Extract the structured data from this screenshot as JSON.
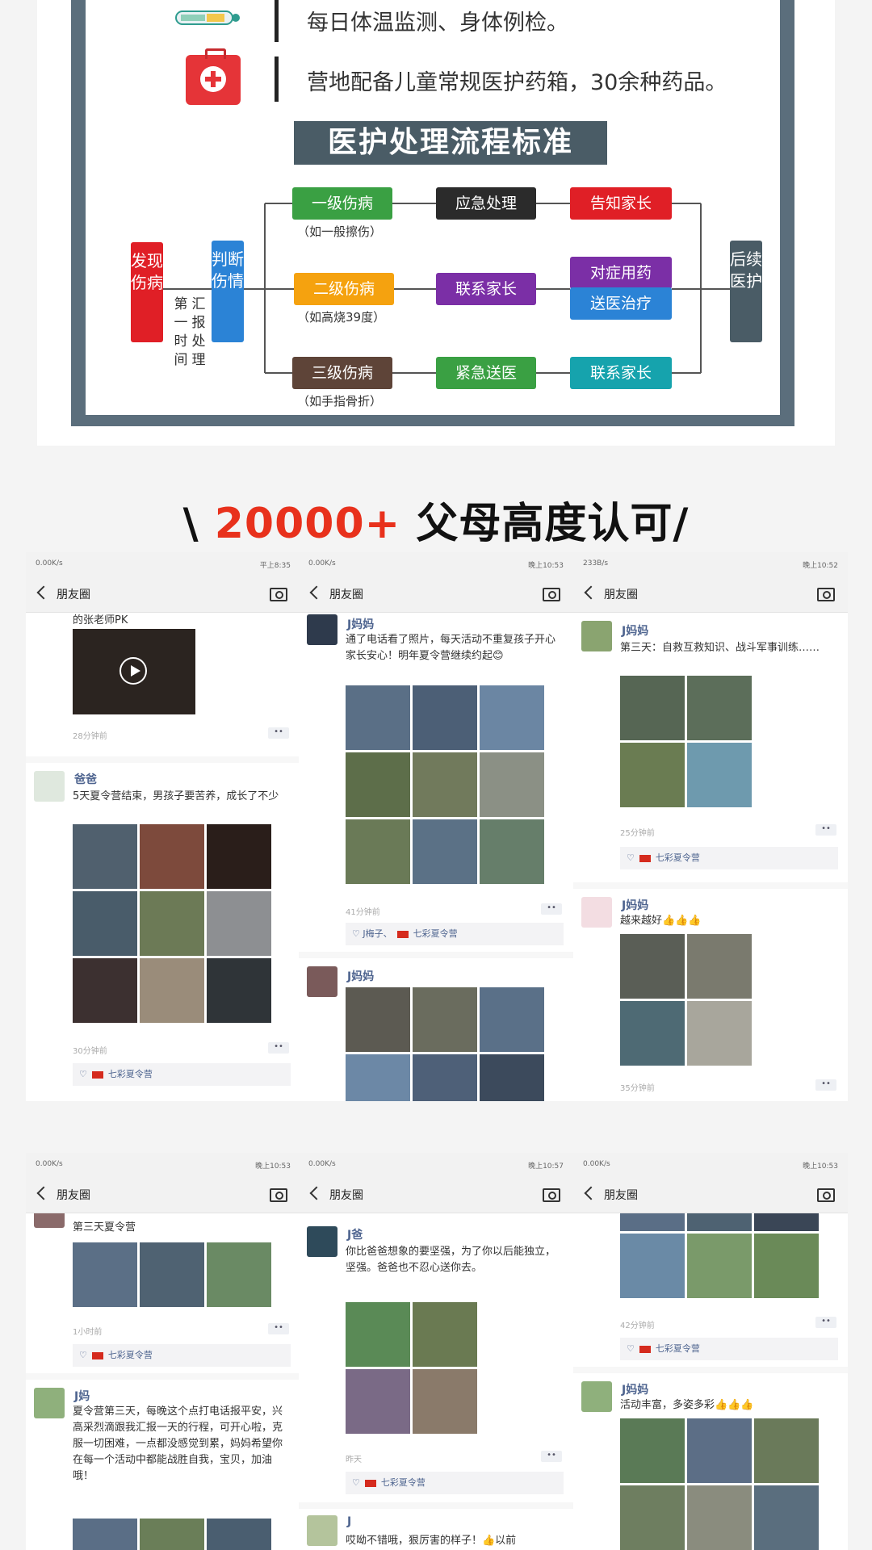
{
  "medical": {
    "row1_text": "每日体温监测、身体例检。",
    "row2_text": "营地配备儿童常规医护药箱，30余种药品。",
    "flow_title": "医护处理流程标准",
    "discover": "发现伤病",
    "judge": "判断伤情",
    "report": "第一时间",
    "report2": "汇报处理",
    "level1": "一级伤病",
    "level1_note": "（如一般擦伤）",
    "level2": "二级伤病",
    "level2_note": "（如高烧39度）",
    "level3": "三级伤病",
    "level3_note": "（如手指骨折）",
    "emergency": "应急处理",
    "contact_parent": "联系家长",
    "urgent_hospital": "紧急送医",
    "notify_parent": "告知家长",
    "medicine": "对症用药",
    "hospital": "送医治疗",
    "contact_parent2": "联系家长",
    "follow_up": "后续医护"
  },
  "headline": {
    "prefix": "\\ ",
    "number": "20000+",
    "suffix": " 父母高度认可/"
  },
  "phones": [
    {
      "status_left": "0.00K/s",
      "status_right": "平上8:35",
      "nav_title": "朋友圈",
      "post1_text": "的张老师PK",
      "post1_time": "28分钟前",
      "post2_name": "爸爸",
      "post2_text": "5天夏令营结束，男孩子要苦养，成长了不少",
      "post2_time": "30分钟前",
      "post2_likes": "七彩夏令营"
    },
    {
      "status_left": "0.00K/s",
      "status_right": "晚上10:53",
      "nav_title": "朋友圈",
      "post1_name": "J妈妈",
      "post1_text": "通了电话看了照片，每天活动不重复孩子开心家长安心！明年夏令营继续约起😊",
      "post1_time": "41分钟前",
      "post1_likes_a": "J梅子、",
      "post1_likes_b": "七彩夏令营",
      "post2_name": "J妈妈"
    },
    {
      "status_left": "233B/s",
      "status_right": "晚上10:52",
      "nav_title": "朋友圈",
      "post1_name": "J妈妈",
      "post1_text": "第三天：自救互救知识、战斗军事训练……",
      "post1_time": "25分钟前",
      "post1_likes": "七彩夏令营",
      "post2_name": "J妈妈",
      "post2_text": "越来越好👍👍👍",
      "post2_time": "35分钟前"
    },
    {
      "status_left": "0.00K/s",
      "status_right": "晚上10:53",
      "nav_title": "朋友圈",
      "post1_text": "第三天夏令营",
      "post1_time": "1小时前",
      "post1_likes": "七彩夏令营",
      "post2_name": "J妈",
      "post2_text": "夏令营第三天，每晚这个点打电话报平安，兴高采烈滴跟我汇报一天的行程，可开心啦，克服一切困难，一点都没感觉到累，妈妈希望你在每一个活动中都能战胜自我，宝贝，加油哦！"
    },
    {
      "status_left": "0.00K/s",
      "status_right": "晚上10:57",
      "nav_title": "朋友圈",
      "post1_name": "J爸",
      "post1_text": "你比爸爸想象的要坚强，为了你以后能独立，坚强。爸爸也不忍心送你去。",
      "post1_time": "昨天",
      "post1_likes": "七彩夏令营",
      "post2_name": "J",
      "post2_text": "哎呦不错哦，狠厉害的样子！👍以前"
    },
    {
      "status_left": "0.00K/s",
      "status_right": "晚上10:53",
      "nav_title": "朋友圈",
      "post1_time": "42分钟前",
      "post1_likes": "七彩夏令营",
      "post2_name": "J妈妈",
      "post2_text": "活动丰富，多姿多彩👍👍👍"
    }
  ],
  "colors": {
    "green": "#3aa043",
    "orange": "#f5a20f",
    "brown": "#5e4438",
    "dark": "#2b2b2b",
    "purple": "#7b2fa6",
    "red": "#e01f26",
    "blue": "#2b83d6",
    "teal": "#16a3ad",
    "slate": "#4a5c66"
  }
}
